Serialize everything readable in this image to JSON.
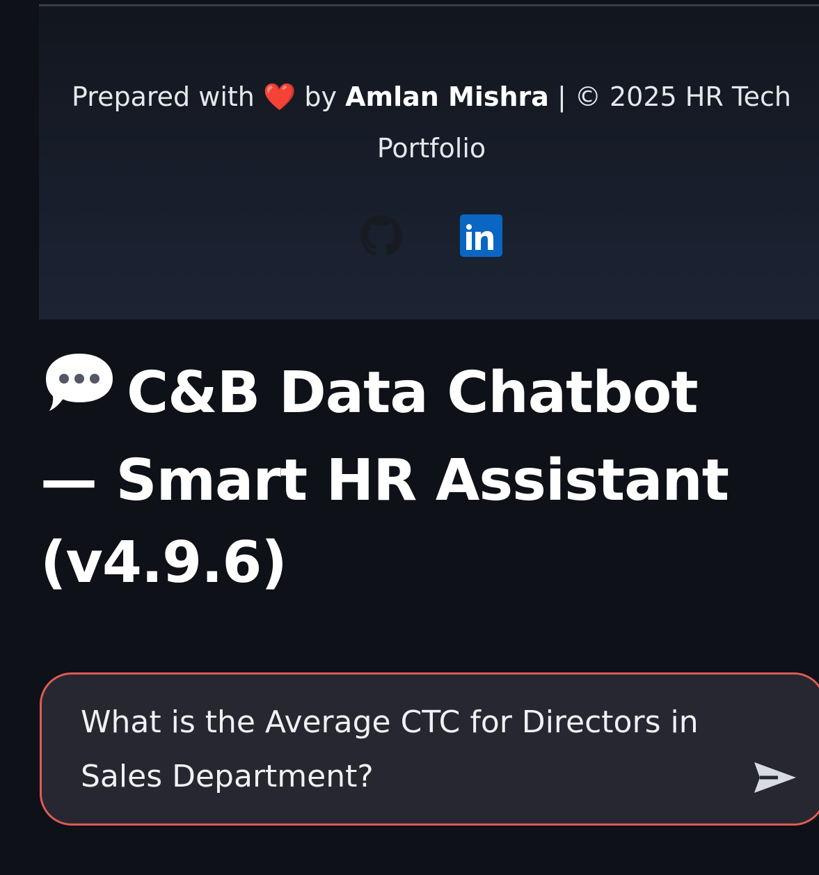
{
  "footer": {
    "prefix": "Prepared with",
    "heart": "❤️",
    "by": "by",
    "author": "Amlan Mishra",
    "suffix": "| © 2025 HR Tech",
    "suffix_line2": "Portfolio",
    "social": [
      {
        "icon": "github-icon"
      },
      {
        "icon": "linkedin-icon",
        "label": "in",
        "color": "#0a66c2"
      }
    ]
  },
  "main": {
    "title_icon": "speech-bubble-icon",
    "title": "C&B Data Chatbot — Smart HR Assistant (v4.9.6)"
  },
  "chat_input": {
    "value": "What is the Average CTC for Directors in Sales Department?",
    "border_color": "#e05a55",
    "send_icon": "send-arrow-icon"
  }
}
